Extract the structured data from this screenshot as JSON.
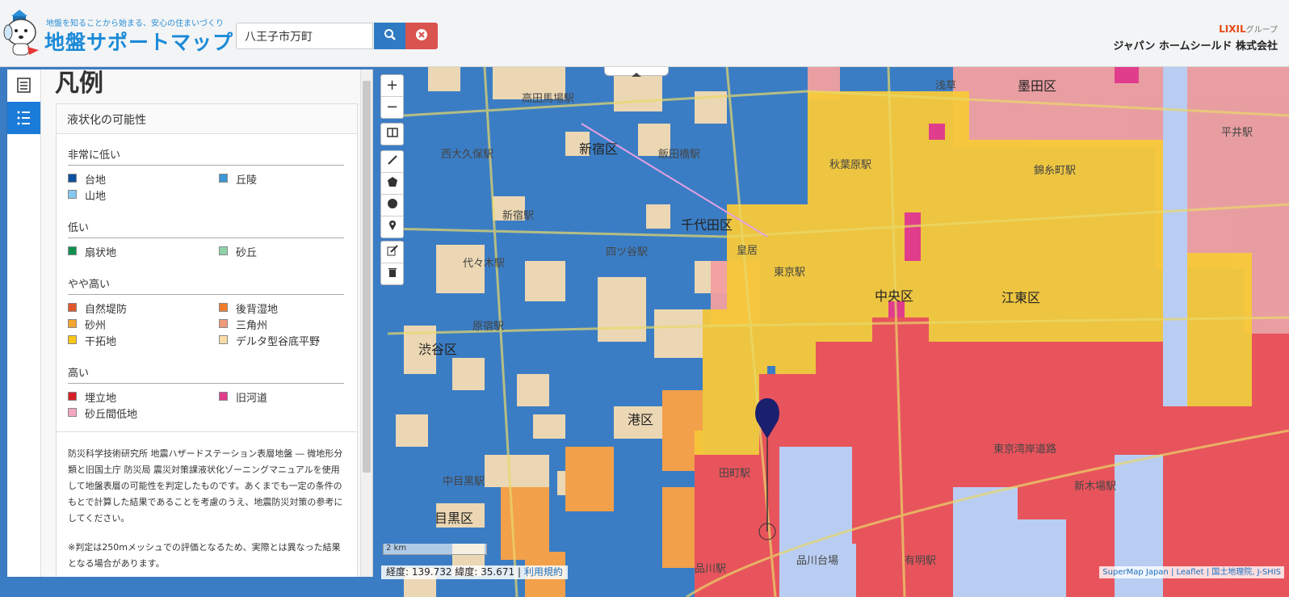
{
  "header": {
    "tagline": "地盤を知ることから始まる、安心の住まいづくり",
    "brand": "地盤サポートマップ",
    "search_value": "八王子市万町",
    "company_group": "LIXIL",
    "company_group_suffix": "グループ",
    "company_name": "ジャパン ホームシールド 株式会社",
    "icons": {
      "search": "search-icon",
      "clear": "clear-circle-icon",
      "mascot": "dog-mascot-icon"
    }
  },
  "sidebar": {
    "tabs": [
      {
        "icon": "list-icon",
        "active": false
      },
      {
        "icon": "legend-list-icon",
        "active": true
      }
    ]
  },
  "legend": {
    "title": "凡例",
    "layer": "液状化の可能性",
    "groups": [
      {
        "name": "非常に低い",
        "items": [
          {
            "label": "台地",
            "color": "#0d4fa0"
          },
          {
            "label": "丘陵",
            "color": "#3b97d6"
          },
          {
            "label": "山地",
            "color": "#84c8f0"
          }
        ]
      },
      {
        "name": "低い",
        "items": [
          {
            "label": "扇状地",
            "color": "#10904f"
          },
          {
            "label": "砂丘",
            "color": "#8fd3a9"
          }
        ]
      },
      {
        "name": "やや高い",
        "items": [
          {
            "label": "自然堤防",
            "color": "#e2572a"
          },
          {
            "label": "後背湿地",
            "color": "#ef7d2c"
          },
          {
            "label": "砂州",
            "color": "#f2a531"
          },
          {
            "label": "三角州",
            "color": "#f09a7c"
          },
          {
            "label": "干拓地",
            "color": "#f7c617"
          },
          {
            "label": "デルタ型谷底平野",
            "color": "#fbdca8"
          }
        ]
      },
      {
        "name": "高い",
        "items": [
          {
            "label": "埋立地",
            "color": "#d7202a"
          },
          {
            "label": "旧河道",
            "color": "#e03d8c"
          },
          {
            "label": "砂丘間低地",
            "color": "#f2a6c0"
          }
        ]
      }
    ],
    "description_1": "防災科学技術研究所 地震ハザードステーション表層地盤 ― 微地形分類と旧国土庁 防災局 震災対策課液状化ゾーニングマニュアルを使用して地盤表層の可能性を判定したものです。あくまでも一定の条件のもとで計算した結果であることを考慮のうえ、地震防災対策の参考にしてください。",
    "description_2": "※判定は250mメッシュでの評価となるため、実際とは異なった結果となる場合があります。"
  },
  "map": {
    "controls": [
      "zoom-in-icon",
      "zoom-out-icon",
      "layers-icon",
      "polyline-icon",
      "polygon-icon",
      "circle-icon",
      "marker-icon",
      "edit-icon",
      "trash-icon"
    ],
    "zoom_in": "+",
    "zoom_out": "−",
    "scale_label": "2 km",
    "coords_text": "経度: 139.732 緯度: 35.671 |",
    "terms_link": "利用規約",
    "attribution": "SuperMap Japan | Leaflet | 国土地理院, J-SHIS",
    "labels": [
      "高田馬場駅",
      "新宿区",
      "飯田橋駅",
      "西大久保駅",
      "新宿駅",
      "千代田区",
      "皇居",
      "代々木駅",
      "四ツ谷駅",
      "原宿駅",
      "渋谷区",
      "東京駅",
      "中央区",
      "江東区",
      "港区",
      "墨田区",
      "錦糸町駅",
      "秋葉原駅",
      "平井駅",
      "目黒区",
      "品川駅",
      "田町駅",
      "有明駅",
      "東京湾岸道路",
      "中目黒駅",
      "新木場駅",
      "品川台場",
      "浅草"
    ],
    "colors": {
      "low": "#3b7dc4",
      "mid_yellow": "#f7c93a",
      "orange": "#f2a04a",
      "high_red": "#e8545c",
      "pink": "#f2a0a0",
      "sand": "#f5dcb3",
      "water": "#b9cdf2"
    }
  }
}
